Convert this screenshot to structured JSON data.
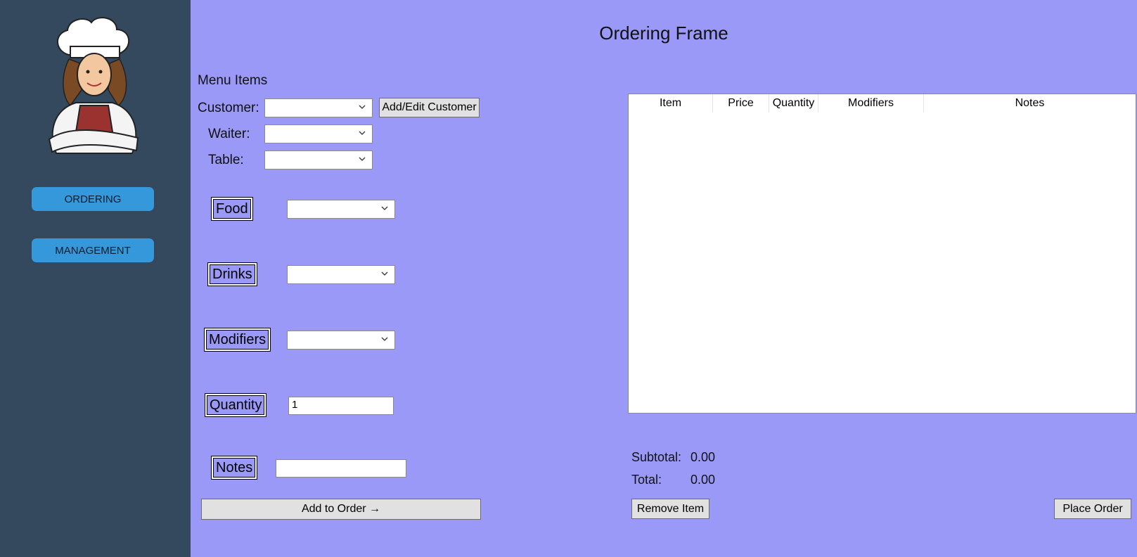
{
  "sidebar": {
    "nav": [
      {
        "label": "ORDERING"
      },
      {
        "label": "MANAGEMENT"
      }
    ]
  },
  "main": {
    "title": "Ordering Frame",
    "section_label": "Menu Items",
    "customer_label": "Customer:",
    "waiter_label": "Waiter:",
    "table_label": "Table:",
    "add_edit_customer_label": "Add/Edit Customer",
    "food_label": "Food",
    "drinks_label": "Drinks",
    "modifiers_label": "Modifiers",
    "quantity_label": "Quantity",
    "quantity_value": "1",
    "notes_label": "Notes",
    "notes_value": "",
    "add_to_order_label": "Add to Order →"
  },
  "order_table": {
    "columns": [
      "Item",
      "Price",
      "Quantity",
      "Modifiers",
      "Notes"
    ],
    "rows": []
  },
  "totals": {
    "subtotal_label": "Subtotal:",
    "subtotal_value": "0.00",
    "total_label": "Total:",
    "total_value": "0.00"
  },
  "actions": {
    "remove_item_label": "Remove Item",
    "place_order_label": "Place Order"
  },
  "colors": {
    "sidebar": "#34495e",
    "background": "#9b99f7",
    "nav_button": "#3498db"
  }
}
